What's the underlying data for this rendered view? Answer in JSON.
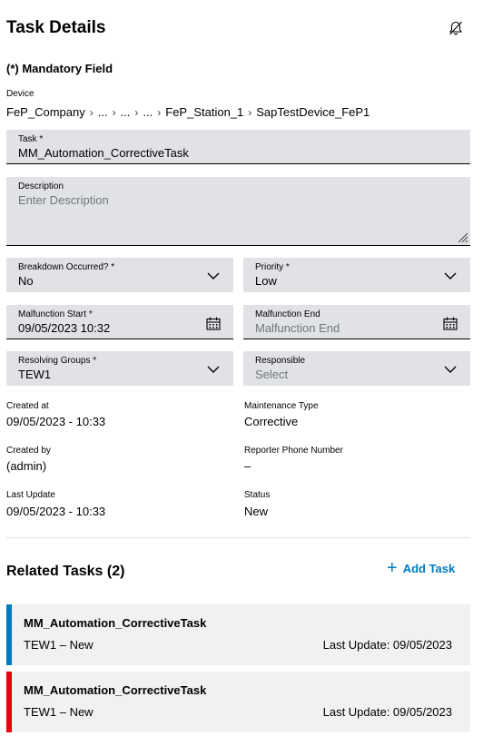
{
  "header": {
    "title": "Task Details",
    "bell_icon": "bell-off-icon"
  },
  "mandatory_note": "(*) Mandatory Field",
  "device": {
    "label": "Device",
    "path": [
      "FeP_Company",
      "...",
      "...",
      "...",
      "FeP_Station_1",
      "SapTestDevice_FeP1"
    ]
  },
  "task": {
    "label": "Task *",
    "value": "MM_Automation_CorrectiveTask"
  },
  "description": {
    "label": "Description",
    "placeholder": "Enter Description",
    "value": ""
  },
  "breakdown": {
    "label": "Breakdown Occurred? *",
    "value": "No"
  },
  "priority": {
    "label": "Priority *",
    "value": "Low"
  },
  "malfunction_start": {
    "label": "Malfunction Start *",
    "value": "09/05/2023 10:32"
  },
  "malfunction_end": {
    "label": "Malfunction End",
    "placeholder": "Malfunction End"
  },
  "resolving_groups": {
    "label": "Resolving Groups *",
    "value": "TEW1"
  },
  "responsible": {
    "label": "Responsible",
    "placeholder": "Select"
  },
  "info": {
    "created_at": {
      "label": "Created at",
      "value": "09/05/2023 - 10:33"
    },
    "maintenance_type": {
      "label": "Maintenance Type",
      "value": "Corrective"
    },
    "created_by": {
      "label": "Created by",
      "value": "(admin)"
    },
    "reporter_phone": {
      "label": "Reporter Phone Number",
      "value": "–"
    },
    "last_update": {
      "label": "Last Update",
      "value": "09/05/2023 - 10:33"
    },
    "status": {
      "label": "Status",
      "value": "New"
    }
  },
  "related": {
    "title": "Related Tasks (2)",
    "add_label": "Add Task",
    "tasks": [
      {
        "name": "MM_Automation_CorrectiveTask",
        "group": "TEW1  –  New",
        "last_update": "Last Update: 09/05/2023",
        "color": "#007bc0"
      },
      {
        "name": "MM_Automation_CorrectiveTask",
        "group": "TEW1  –  New",
        "last_update": "Last Update: 09/05/2023",
        "color": "#ed0007"
      }
    ]
  }
}
